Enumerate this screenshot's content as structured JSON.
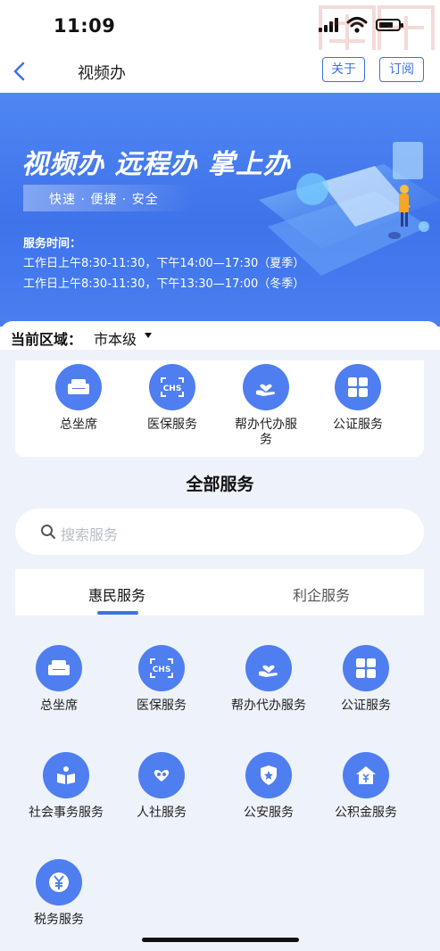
{
  "status_bar": {
    "time": "11:09"
  },
  "nav": {
    "title": "视频办",
    "about_label": "关于",
    "subscribe_label": "订阅"
  },
  "banner": {
    "headline": "视频办 远程办 掌上办",
    "tags": "快速 · 便捷 · 安全",
    "hours_label": "服务时间：",
    "hours_summer": "工作日上午8:30-11:30，下午14:00—17:30（夏季）",
    "hours_winter": "工作日上午8:30-11:30，下午13:30—17:00（冬季）"
  },
  "region": {
    "label": "当前区域：",
    "value": "市本级"
  },
  "quick_services": [
    {
      "label": "总坐席",
      "icon": "sofa-icon"
    },
    {
      "label": "医保服务",
      "icon": "chs-scan-icon"
    },
    {
      "label": "帮办代办服\n务",
      "icon": "heart-hand-icon"
    },
    {
      "label": "公证服务",
      "icon": "grid-icon"
    }
  ],
  "all_services": {
    "title": "全部服务",
    "search_placeholder": "搜索服务"
  },
  "tabs": [
    {
      "label": "惠民服务",
      "active": true
    },
    {
      "label": "利企服务",
      "active": false
    }
  ],
  "services": [
    {
      "label": "总坐席",
      "icon": "sofa-icon"
    },
    {
      "label": "医保服务",
      "icon": "chs-scan-icon"
    },
    {
      "label": "帮办代办服务",
      "icon": "heart-hand-icon"
    },
    {
      "label": "公证服务",
      "icon": "grid-icon"
    },
    {
      "label": "社会事务服务",
      "icon": "book-person-icon"
    },
    {
      "label": "人社服务",
      "icon": "heart-people-icon"
    },
    {
      "label": "公安服务",
      "icon": "police-shield-icon"
    },
    {
      "label": "公积金服务",
      "icon": "house-yen-icon"
    },
    {
      "label": "税务服务",
      "icon": "yen-coin-icon"
    }
  ],
  "colors": {
    "accent": "#3f6fe6",
    "icon_bg": "#4f7ef0",
    "page_bg": "#eef2fb"
  }
}
